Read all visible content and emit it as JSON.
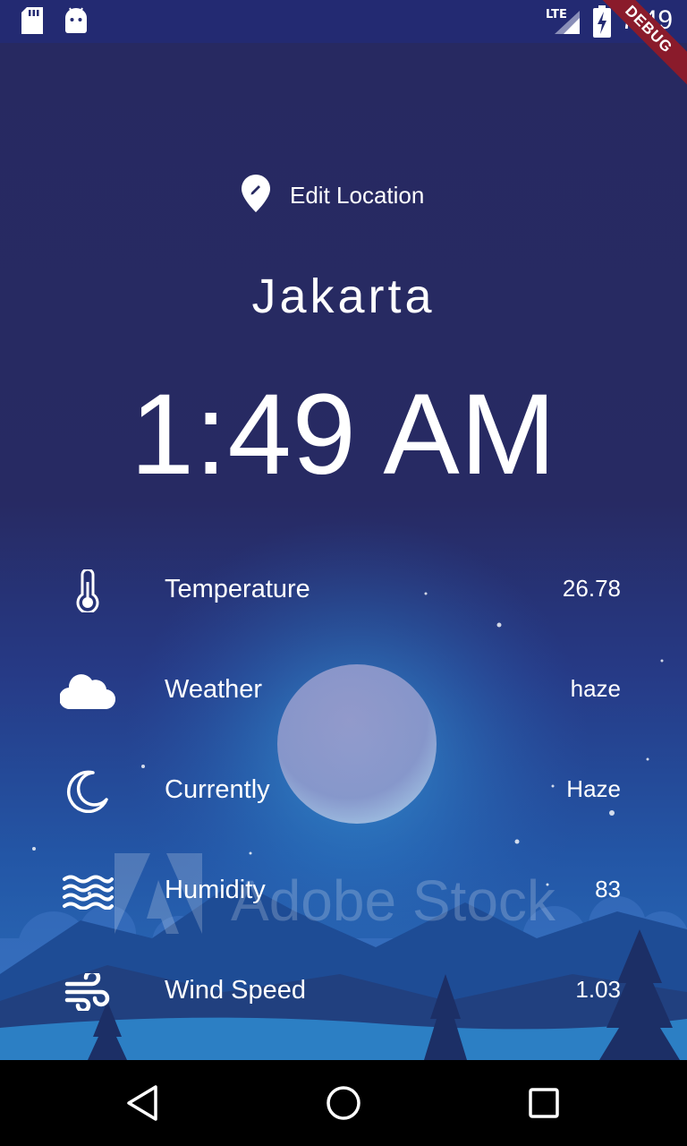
{
  "status_bar": {
    "time": "7:49",
    "network": "LTE",
    "icons": [
      "sd-card-icon",
      "android-icon",
      "signal-icon",
      "battery-charging-icon"
    ]
  },
  "debug_banner": "DEBUG",
  "edit_location": {
    "label": "Edit Location",
    "icon": "location-edit-icon"
  },
  "city": "Jakarta",
  "time": "1:49 AM",
  "rows": [
    {
      "label": "Temperature",
      "value": "26.78",
      "icon": "thermometer-icon"
    },
    {
      "label": "Weather",
      "value": "haze",
      "icon": "cloud-icon"
    },
    {
      "label": "Currently",
      "value": "Haze",
      "icon": "moon-icon"
    },
    {
      "label": "Humidity",
      "value": "83",
      "icon": "waves-icon"
    },
    {
      "label": "Wind Speed",
      "value": "1.03",
      "icon": "wind-icon"
    }
  ],
  "watermark": "Adobe Stock",
  "nav": [
    "back-button",
    "home-button",
    "recents-button"
  ],
  "colors": {
    "status_bar": "#232a72",
    "background_top": "#272961",
    "ribbon": "#8a1b2b"
  }
}
